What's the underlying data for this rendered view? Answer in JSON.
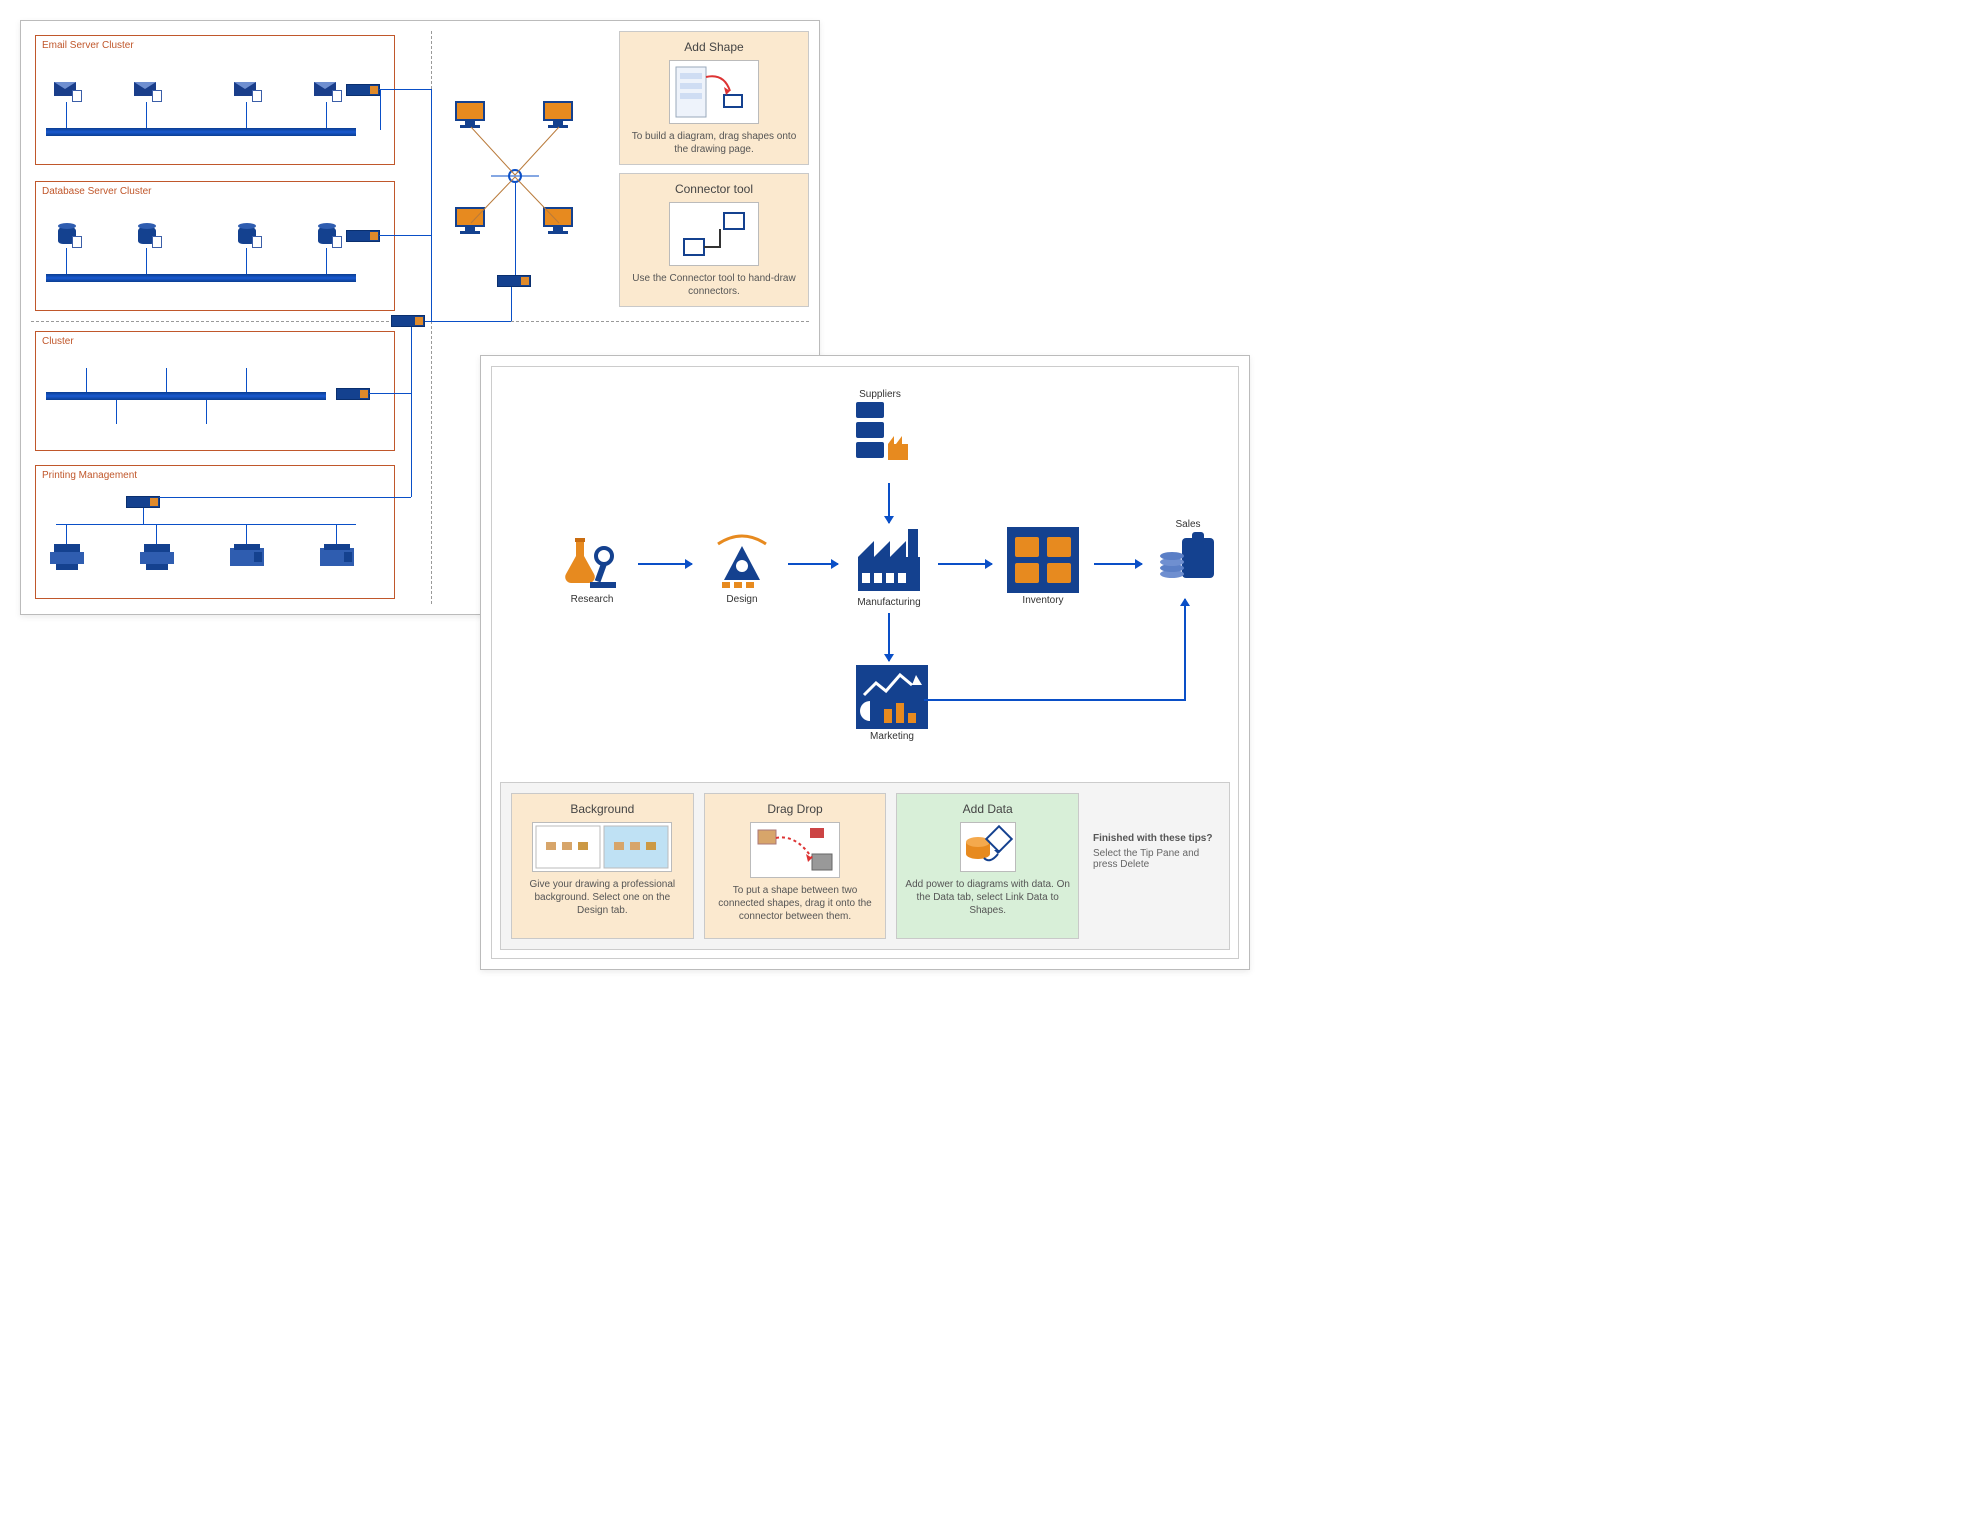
{
  "panel_a": {
    "clusters": {
      "email": {
        "title": "Email Server Cluster"
      },
      "db": {
        "title": "Database Server Cluster"
      },
      "generic": {
        "title": "Cluster"
      },
      "print": {
        "title": "Printing Management"
      }
    },
    "tips": {
      "add_shape": {
        "title": "Add Shape",
        "text": "To build a diagram, drag shapes onto the drawing page."
      },
      "connector": {
        "title": "Connector tool",
        "text": "Use the Connector tool to hand-draw connectors."
      }
    }
  },
  "panel_b": {
    "nodes": {
      "research": {
        "label": "Research"
      },
      "design": {
        "label": "Design"
      },
      "manufacturing": {
        "label": "Manufacturing"
      },
      "inventory": {
        "label": "Inventory"
      },
      "sales": {
        "label": "Sales"
      },
      "suppliers": {
        "label": "Suppliers"
      },
      "marketing": {
        "label": "Marketing"
      }
    },
    "tips": {
      "background": {
        "title": "Background",
        "text": "Give your drawing a professional background. Select one on the Design tab."
      },
      "dragdrop": {
        "title": "Drag Drop",
        "text": "To put a shape between two connected shapes, drag it onto the connector between them."
      },
      "adddata": {
        "title": "Add Data",
        "text": "Add power to diagrams with data. On the Data tab, select Link Data to Shapes."
      },
      "finished": {
        "title": "Finished with these tips?",
        "text": "Select the Tip Pane and press Delete"
      }
    }
  }
}
